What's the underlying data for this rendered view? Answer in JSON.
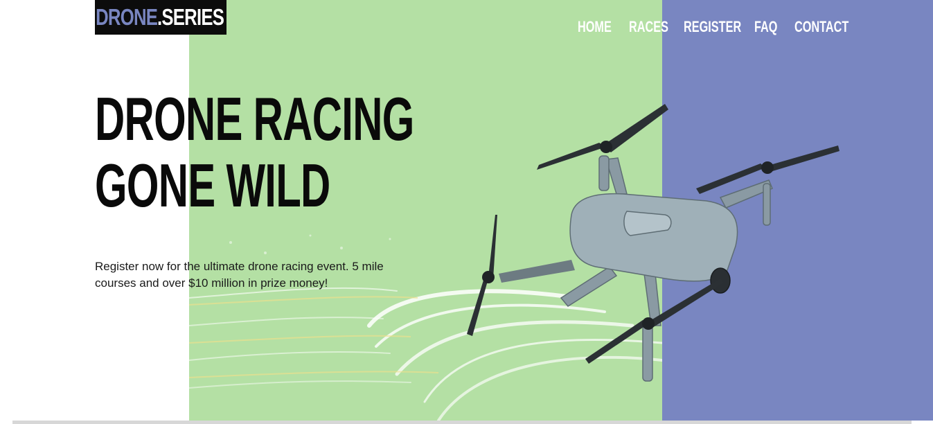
{
  "brand": {
    "logo_part1": "DRONE",
    "logo_part2": ".SERIES"
  },
  "nav": {
    "items": [
      {
        "label": "HOME"
      },
      {
        "label": "RACES"
      },
      {
        "label": "REGISTER"
      },
      {
        "label": "FAQ"
      },
      {
        "label": "CONTACT"
      }
    ]
  },
  "hero": {
    "title_line1": "DRONE RACING",
    "title_line2": "GONE WILD",
    "description": "Register now for the ultimate drone racing event. 5 mile courses and over $10 million in prize money!",
    "image_icon": "drone-icon"
  },
  "colors": {
    "green_panel": "#b4e0a4",
    "purple_panel": "#7986c1",
    "logo_bg": "#0c0c0c",
    "logo_accent": "#7986c1",
    "text_dark": "#0a0a0a"
  }
}
